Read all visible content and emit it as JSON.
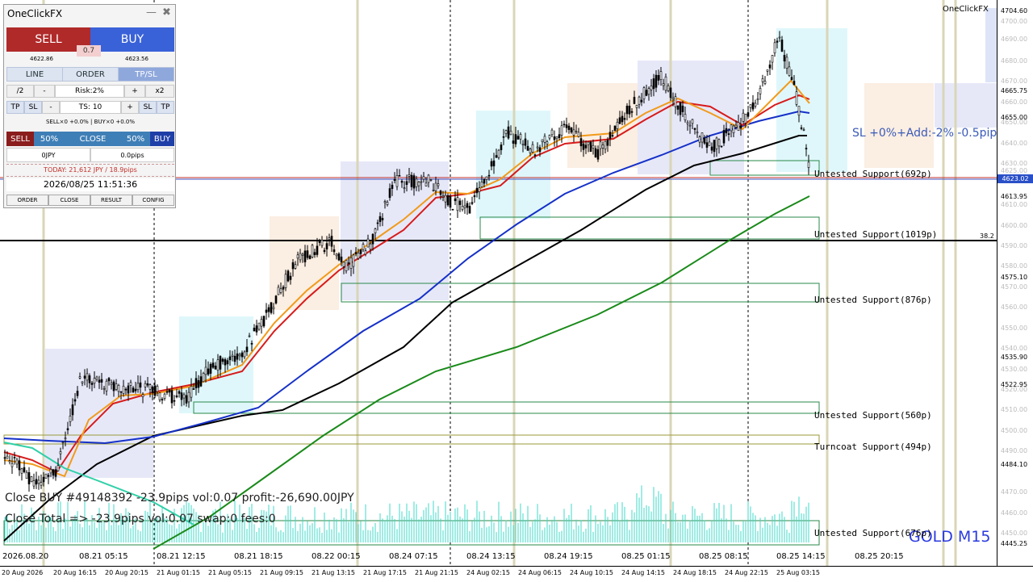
{
  "panel": {
    "title": "OneClickFX",
    "minimize_glyph": "—",
    "close_glyph": "✖",
    "sell_label": "SELL",
    "buy_label": "BUY",
    "spread": "0.7",
    "bid": "4622.86",
    "ask": "4623.56",
    "tabs": [
      "LINE",
      "ORDER",
      "TP/SL"
    ],
    "row1": {
      "half": "/2",
      "minus": "-",
      "risk": "Risk:2%",
      "plus": "+",
      "double": "x2"
    },
    "row2": {
      "tp_left": "TP",
      "sl_left": "SL",
      "minus": "-",
      "ts": "TS: 10",
      "plus": "+",
      "sl_right": "SL",
      "tp_right": "TP"
    },
    "positions": "SELL×0 +0.0%  |  BUY×0 +0.0%",
    "row3": {
      "sell": "SELL",
      "pct_left": "50%",
      "close": "CLOSE",
      "pct_right": "50%",
      "buy": "BUY"
    },
    "jpy": "0JPY",
    "pips": "0.0pips",
    "today": "TODAY: 21,612 JPY / 18.9pips",
    "datetime": "2026/08/25  11:51:36",
    "footer": [
      "ORDER",
      "CLOSE",
      "RESULT",
      "CONFIG"
    ]
  },
  "chart": {
    "indicator_name": "OneClickFX",
    "sl_info": "SL +0%+Add:-2% -0.5pips",
    "symbol_tf": "GOLD M15",
    "level_label": "38.2",
    "close_msg_1": "Close BUY #49148392 -23.9pips vol:0.07 profit:-26,690.00JPY",
    "close_msg_2": "Close Total =>  -23.9pips vol:0.07 swap:0 fees:0",
    "supports": [
      "Untested Support(692p)",
      "Untested Support(1019p)",
      "Untested Support(876p)",
      "Untested Support(560p)",
      "Turncoat Support(494p)",
      "Untested Support(676p)"
    ],
    "inner_dates": [
      "2026.08.20",
      "08.21 05:15",
      "08.21 12:15",
      "08.21 18:15",
      "08.22 00:15",
      "08.24 07:15",
      "08.24 13:15",
      "08.24 19:15",
      "08.25 01:15",
      "08.25 08:15",
      "08.25 14:15",
      "08.25 20:15"
    ],
    "price_ticks": [
      "4704.60",
      "4700.00",
      "4690.00",
      "4680.00",
      "4670.00",
      "4665.75",
      "4660.00",
      "4655.00",
      "4650.00",
      "4640.00",
      "4630.00",
      "4625.00",
      "4613.95",
      "4610.00",
      "4600.00",
      "4590.00",
      "4580.00",
      "4575.10",
      "4570.00",
      "4560.00",
      "4550.00",
      "4540.00",
      "4535.90",
      "4530.00",
      "4522.95",
      "4520.00",
      "4510.00",
      "4500.00",
      "4490.00",
      "4484.10",
      "4470.00",
      "4460.00",
      "4450.00",
      "4445.25"
    ],
    "current_price": "4623.02",
    "time_labels": [
      "20 Aug 2026",
      "20 Aug 16:15",
      "20 Aug 20:15",
      "21 Aug 01:15",
      "21 Aug 05:15",
      "21 Aug 09:15",
      "21 Aug 13:15",
      "21 Aug 17:15",
      "21 Aug 21:15",
      "24 Aug 02:15",
      "24 Aug 06:15",
      "24 Aug 10:15",
      "24 Aug 14:15",
      "24 Aug 18:15",
      "24 Aug 22:15",
      "25 Aug 03:15"
    ],
    "colors": {
      "bull": "#000000",
      "ma_fast": "#d81b1b",
      "ma_orange": "#f29a1a",
      "ma_blue": "#1530c8",
      "ma_black": "#000000",
      "ma_green": "#1a8a1a",
      "volume": "#40d8c8",
      "current_badge": "#2a50c8"
    }
  }
}
